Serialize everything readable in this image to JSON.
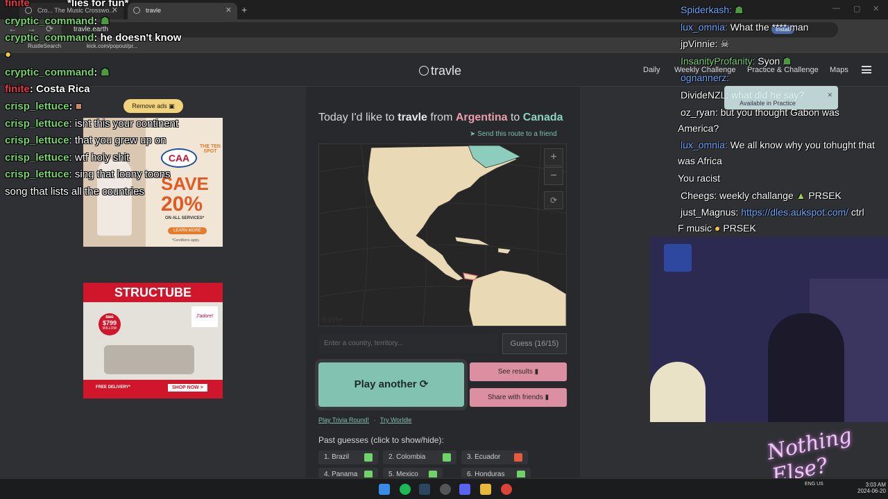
{
  "browser": {
    "tabs": [
      {
        "label": "Cro... The Music Crosswo..."
      },
      {
        "label": "travle"
      }
    ],
    "url": "travle.earth",
    "install_label": "Install",
    "bookmarks": [
      "RustleSearch",
      "kick.com/popout/pr..."
    ]
  },
  "site": {
    "logo": "travle",
    "nav": [
      "Daily",
      "Weekly Challenge",
      "Practice & Challenge",
      "Maps"
    ]
  },
  "game": {
    "prompt_pre": "Today I'd like to",
    "prompt_word": "travle",
    "prompt_from": "from",
    "origin": "Argentina",
    "prompt_to": "to",
    "destination": "Canada",
    "send_route": "Send this route to a friend",
    "zoom_in": "+",
    "zoom_out": "−",
    "map_watermark": "travle",
    "input_placeholder": "Enter a country, territory...",
    "guess_count": "Guess (16/15)",
    "play_another": "Play another",
    "see_results": "See results",
    "share": "Share with friends",
    "link_trivia": "Play Trivia Round!",
    "link_sep": "·",
    "link_worldle": "Try Worldle",
    "past_title": "Past guesses (click to show/hide):",
    "past_guesses": [
      {
        "num": "1.",
        "name": "Brazil",
        "status": "#6fd36a"
      },
      {
        "num": "2.",
        "name": "Colombia",
        "status": "#6fd36a"
      },
      {
        "num": "3.",
        "name": "Ecuador",
        "status": "#e85a3c"
      },
      {
        "num": "4.",
        "name": "Panama",
        "status": "#6fd36a"
      },
      {
        "num": "5.",
        "name": "Mexico",
        "status": "#6fd36a"
      },
      {
        "num": "6.",
        "name": "Honduras",
        "status": "#6fd36a"
      }
    ]
  },
  "ads": {
    "remove_ads": "Remove ads",
    "caa": {
      "logo": "CAA",
      "headline": "SAVE",
      "percent": "20%",
      "sub": "ON ALL SERVICES*",
      "cta": "LEARN MORE",
      "fine": "*Conditions apply.",
      "side": "THE TEN SPOT"
    },
    "structube": {
      "brand": "STRUCTUBE",
      "old_price": "$899",
      "price": "$799",
      "product": "WILLOW",
      "free": "FREE DELIVERY*",
      "shop": "SHOP NOW >",
      "tag": "J'adore!"
    }
  },
  "chat_left": [
    {
      "user": "finite",
      "msg": "*lies for fun*"
    },
    {
      "user": "cryptic_command",
      "msg": ""
    },
    {
      "user": "cryptic_command",
      "msg": "he doesn't know"
    },
    {
      "user": "cryptic_command",
      "msg": ""
    },
    {
      "user": "finite",
      "msg": "Costa Rica"
    },
    {
      "user": "crisp_lettuce",
      "msg": ""
    },
    {
      "user": "crisp_lettuce",
      "msg": "isnt this your continent"
    },
    {
      "user": "crisp_lettuce",
      "msg": "that you grew up on"
    },
    {
      "user": "crisp_lettuce",
      "msg": "wtf holy shit"
    },
    {
      "user": "crisp_lettuce",
      "msg": "sing that loony toons"
    },
    {
      "user": "",
      "msg": "song that lists all the countries"
    }
  ],
  "chat_right": [
    {
      "user": "Spiderkash:",
      "msg": ""
    },
    {
      "user": "lux_omnia:",
      "msg": "What the **** man"
    },
    {
      "user": "",
      "msg": "jpVinnie:"
    },
    {
      "user": "InsanityProfanity:",
      "msg": "Syon"
    },
    {
      "user": "ognannerz:",
      "msg": ""
    },
    {
      "user": "",
      "msg": "DivideNZL: what did he say?"
    },
    {
      "user": "",
      "msg": "oz_ryan: but you thought Gabon was"
    },
    {
      "user": "",
      "msg": "America?"
    },
    {
      "user": "lux_omnia:",
      "msg": "We all know why you tohught that"
    },
    {
      "user": "",
      "msg": "was Africa"
    },
    {
      "user": "",
      "msg": "You racist"
    },
    {
      "user": "",
      "msg": "Cheegs: weekly challange"
    },
    {
      "user": "",
      "msg": "PRSEK"
    },
    {
      "user": "",
      "msg": "just_Magnus:"
    },
    {
      "user": "https://dles.aukspot.com/",
      "msg": "ctrl"
    },
    {
      "user": "",
      "msg": "F music"
    },
    {
      "user": "",
      "msg": "PRSEK"
    }
  ],
  "popup": {
    "title": "what did he say?",
    "sub": "Available in Practice"
  },
  "overlay_brand": "Nothing Else?",
  "taskbar": {
    "lang": "ENG US",
    "time": "3:03 AM",
    "date": "2024-06-20"
  }
}
